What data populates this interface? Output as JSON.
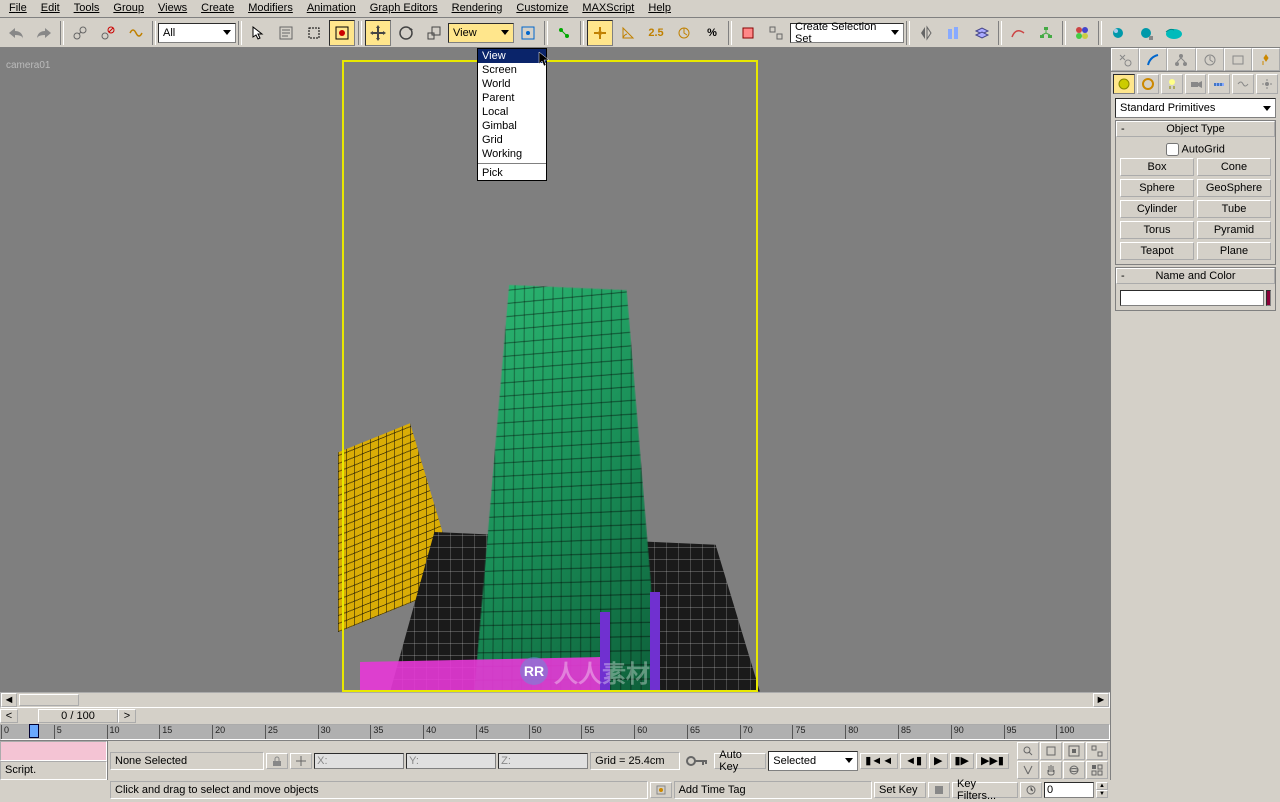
{
  "menu": [
    "File",
    "Edit",
    "Tools",
    "Group",
    "Views",
    "Create",
    "Modifiers",
    "Animation",
    "Graph Editors",
    "Rendering",
    "Customize",
    "MAXScript",
    "Help"
  ],
  "toolbar": {
    "filter_dropdown": "All",
    "ref_dropdown": "View",
    "selset_dropdown": "Create Selection Set",
    "snap_value": "2.5"
  },
  "ref_menu": {
    "items": [
      "View",
      "Screen",
      "World",
      "Parent",
      "Local",
      "Gimbal",
      "Grid",
      "Working"
    ],
    "pick": "Pick",
    "selected": "View"
  },
  "viewport": {
    "label": "camera01"
  },
  "right_panel": {
    "category_dropdown": "Standard Primitives",
    "rollout_objtype": "Object Type",
    "autogrid": "AutoGrid",
    "primitives": [
      "Box",
      "Cone",
      "Sphere",
      "GeoSphere",
      "Cylinder",
      "Tube",
      "Torus",
      "Pyramid",
      "Teapot",
      "Plane"
    ],
    "rollout_name": "Name and Color"
  },
  "timeline": {
    "handle": "0 / 100",
    "ticks": [
      "0",
      "5",
      "10",
      "15",
      "20",
      "25",
      "30",
      "35",
      "40",
      "45",
      "50",
      "55",
      "60",
      "65",
      "70",
      "75",
      "80",
      "85",
      "90",
      "95",
      "100"
    ]
  },
  "status": {
    "script": "Script.",
    "selection": "None Selected",
    "prompt": "Click and drag to select and move objects",
    "x": "X:",
    "y": "Y:",
    "z": "Z:",
    "grid": "Grid = 25.4cm",
    "timetag": "Add Time Tag",
    "autokey": "Auto Key",
    "setkey": "Set Key",
    "keyfilters": "Key Filters...",
    "selected": "Selected",
    "frame": "0"
  }
}
